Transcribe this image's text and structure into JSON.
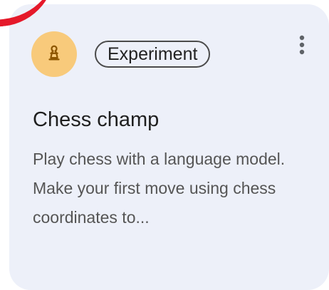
{
  "card": {
    "badge_label": "Experiment",
    "title": "Chess champ",
    "description": "Play chess with a language model. Make your first move using chess coordinates to...",
    "icons": {
      "avatar": "chess-pawn-icon",
      "menu": "more-vertical-icon"
    },
    "colors": {
      "card_background": "#edf0f9",
      "avatar_background": "#f8ca7b",
      "annotation_red": "#e5192a"
    }
  }
}
